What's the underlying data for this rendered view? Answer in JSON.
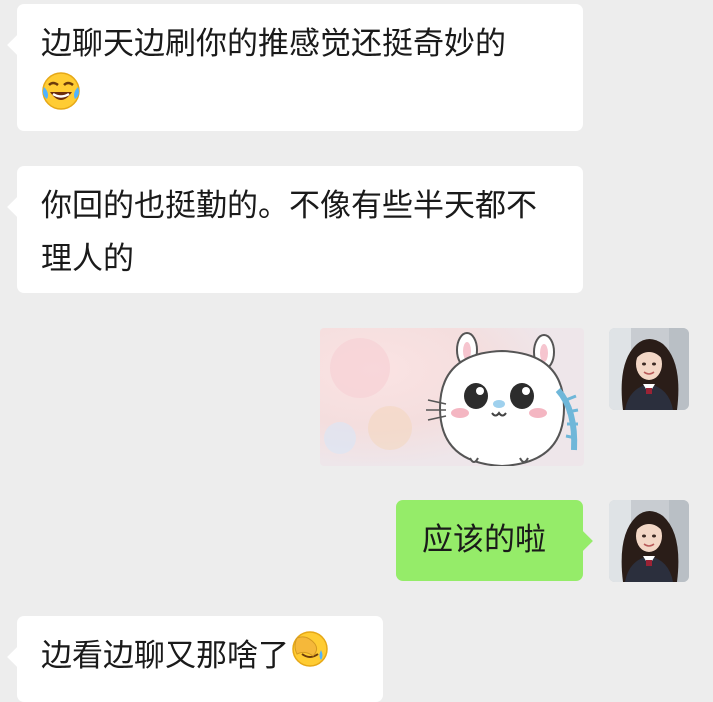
{
  "messages": [
    {
      "side": "left",
      "text": "边聊天边刷你的推感觉还挺奇妙的",
      "emoji": "face-with-tears-of-joy"
    },
    {
      "side": "left",
      "text": "你回的也挺勤的。不像有些半天都不理人的"
    },
    {
      "side": "right",
      "type": "sticker",
      "sticker": "white-hamster-sticker"
    },
    {
      "side": "right",
      "text": "应该的啦"
    },
    {
      "side": "left",
      "text": "边看边聊又那啥了",
      "emoji": "face-palm"
    }
  ],
  "colors": {
    "background": "#ededed",
    "incoming_bubble": "#ffffff",
    "outgoing_bubble": "#95ec69"
  }
}
